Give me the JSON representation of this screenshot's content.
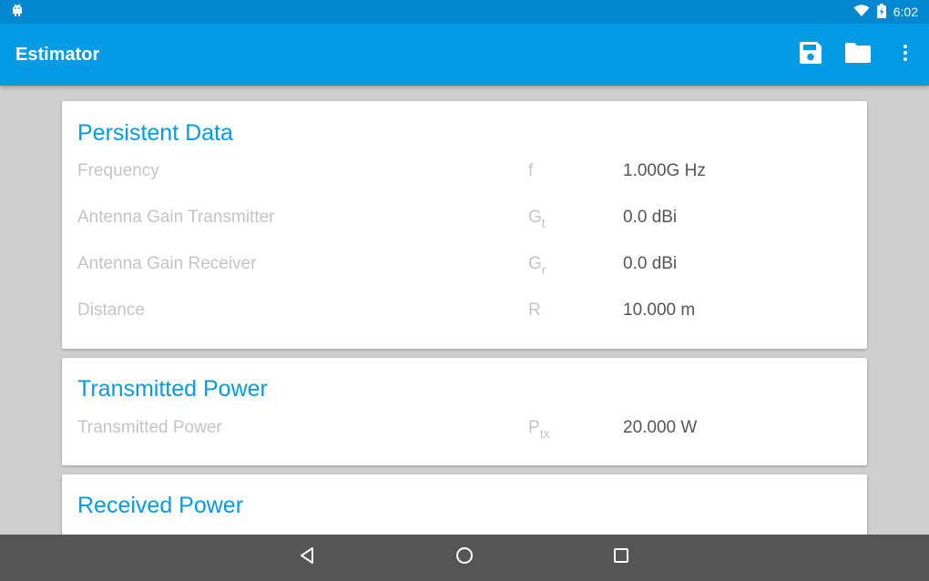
{
  "status_bar": {
    "time": "6:02",
    "icons": [
      "android-notification-icon",
      "wifi-icon",
      "battery-charging-icon"
    ]
  },
  "app_bar": {
    "title": "Estimator",
    "actions": [
      "save-icon",
      "folder-icon",
      "more-vert-icon"
    ]
  },
  "cards": {
    "persistent": {
      "title": "Persistent Data",
      "rows": [
        {
          "label": "Frequency",
          "symbol": "f",
          "symbol_sub": "",
          "value": "1.000G Hz"
        },
        {
          "label": "Antenna Gain Transmitter",
          "symbol": "G",
          "symbol_sub": "t",
          "value": "0.0 dBi"
        },
        {
          "label": "Antenna Gain Receiver",
          "symbol": "G",
          "symbol_sub": "r",
          "value": "0.0 dBi"
        },
        {
          "label": "Distance",
          "symbol": "R",
          "symbol_sub": "",
          "value": "10.000 m"
        }
      ]
    },
    "transmitted": {
      "title": "Transmitted Power",
      "rows": [
        {
          "label": "Transmitted Power",
          "symbol": "P",
          "symbol_sub": "tx",
          "value": "20.000 W"
        }
      ]
    },
    "received": {
      "title": "Received Power"
    }
  },
  "nav_bar": {
    "buttons": [
      "back-icon",
      "home-icon",
      "recents-icon"
    ]
  },
  "colors": {
    "status_bar": "#0288d1",
    "app_bar": "#039be5",
    "accent": "#039be5",
    "background": "#cfcfcf",
    "nav_bar": "#555555"
  }
}
